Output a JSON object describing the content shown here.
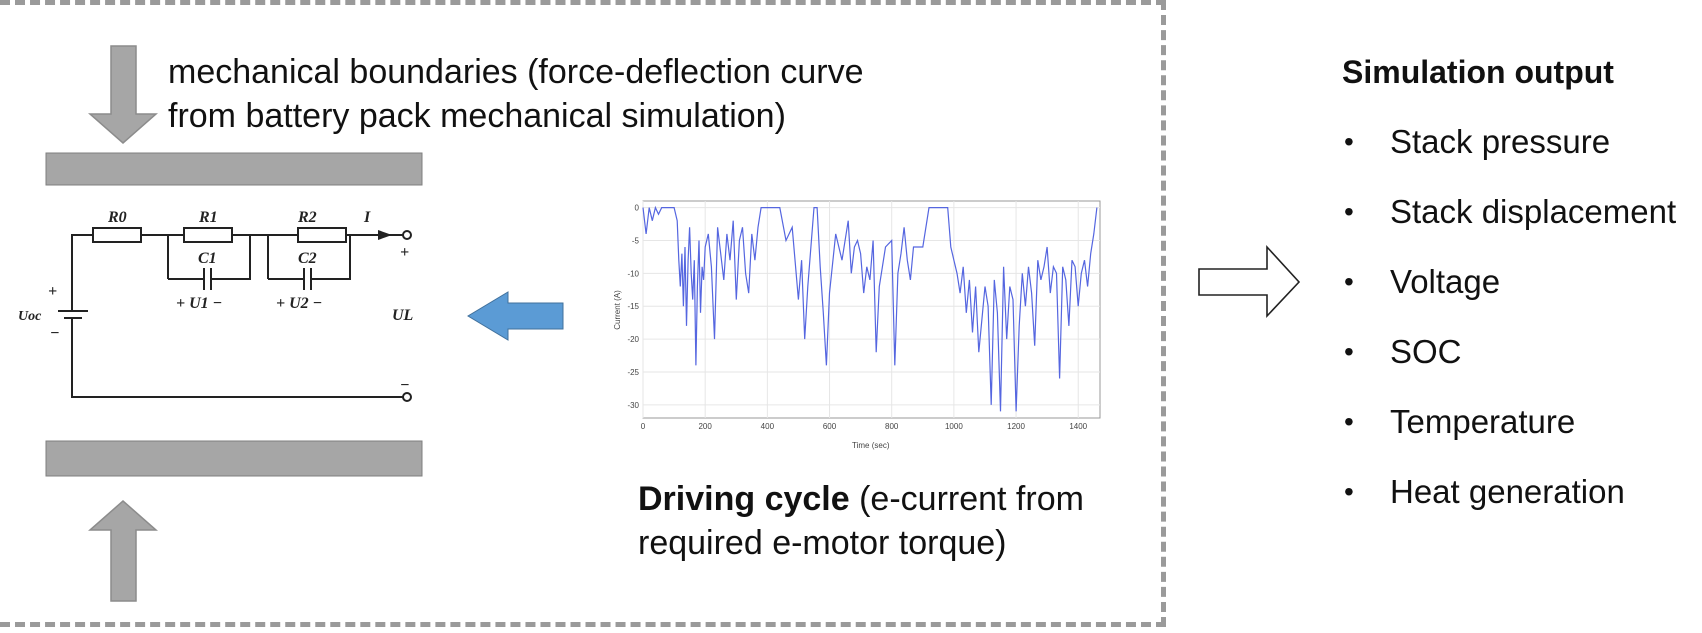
{
  "mechanical_label": {
    "line1": "mechanical boundaries (force-deflection curve",
    "line2": "from battery pack mechanical simulation)"
  },
  "circuit": {
    "R0": "R0",
    "R1": "R1",
    "R2": "R2",
    "C1": "C1",
    "C2": "C2",
    "U1": "+ U1 −",
    "U2": "+ U2 −",
    "Uoc": "Uoc",
    "I": "I",
    "UL": "UL",
    "plus": "+",
    "minus": "−"
  },
  "driving_cycle": {
    "bold": "Driving cycle",
    "rest_line1": " (e-current from",
    "line2": "required e-motor torque)"
  },
  "output": {
    "title": "Simulation output",
    "bullet": "•",
    "items": [
      "Stack pressure",
      "Stack displacement",
      "Voltage",
      "SOC",
      "Temperature",
      "Heat generation"
    ]
  },
  "colors": {
    "arrow_blue": "#5b9bd5",
    "plate_gray": "#a6a6a6",
    "line_blue": "#5566e0",
    "dash_gray": "#9a9a9a"
  },
  "chart_data": {
    "type": "line",
    "xlabel": "Time (sec)",
    "ylabel": "Current (A)",
    "xlim": [
      0,
      1470
    ],
    "ylim": [
      -32,
      1
    ],
    "x_ticks": [
      0,
      200,
      400,
      600,
      800,
      1000,
      1200,
      1400
    ],
    "y_ticks": [
      0,
      -5,
      -10,
      -15,
      -20,
      -25,
      -30
    ],
    "series": [
      {
        "x": [
          0,
          10,
          20,
          30,
          40,
          50,
          60,
          70,
          80,
          90,
          100,
          110,
          115,
          120,
          125,
          130,
          135,
          140,
          145,
          150,
          155,
          160,
          165,
          170,
          175,
          180,
          185,
          190,
          195,
          200,
          210,
          220,
          230,
          240,
          250,
          260,
          270,
          280,
          290,
          300,
          310,
          320,
          330,
          340,
          350,
          360,
          370,
          380,
          390,
          400,
          420,
          440,
          460,
          480,
          500,
          510,
          520,
          530,
          540,
          550,
          560,
          570,
          580,
          590,
          600,
          620,
          640,
          660,
          670,
          680,
          690,
          700,
          710,
          720,
          730,
          740,
          750,
          760,
          780,
          800,
          810,
          820,
          830,
          840,
          850,
          860,
          870,
          880,
          890,
          900,
          920,
          940,
          960,
          980,
          990,
          1000,
          1010,
          1020,
          1030,
          1040,
          1050,
          1060,
          1070,
          1080,
          1090,
          1100,
          1110,
          1120,
          1130,
          1140,
          1150,
          1160,
          1170,
          1180,
          1190,
          1200,
          1210,
          1220,
          1230,
          1240,
          1250,
          1260,
          1270,
          1280,
          1290,
          1300,
          1310,
          1320,
          1330,
          1340,
          1350,
          1360,
          1370,
          1380,
          1390,
          1400,
          1410,
          1420,
          1430,
          1440,
          1450,
          1460
        ],
        "y": [
          0,
          -4,
          0,
          -2,
          0,
          -1,
          0,
          0,
          0,
          0,
          0,
          -2,
          -8,
          -12,
          -7,
          -15,
          -6,
          -18,
          -8,
          -3,
          -10,
          -14,
          -8,
          -24,
          -12,
          -5,
          -16,
          -9,
          -11,
          -6,
          -4,
          -9,
          -20,
          -3,
          -7,
          -11,
          -4,
          -8,
          -2,
          -14,
          -5,
          -3,
          -10,
          -13,
          -4,
          -8,
          -3,
          0,
          0,
          0,
          0,
          0,
          -5,
          -3,
          -14,
          -8,
          -20,
          -12,
          -6,
          0,
          0,
          -9,
          -16,
          -24,
          -13,
          -4,
          -8,
          -2,
          -10,
          -6,
          -5,
          -7,
          -13,
          -9,
          -11,
          -5,
          -22,
          -12,
          -6,
          -5,
          -24,
          -10,
          -7,
          -3,
          -8,
          -11,
          -6,
          -6,
          -6,
          -6,
          0,
          0,
          0,
          0,
          -6,
          -8,
          -10,
          -13,
          -9,
          -16,
          -11,
          -19,
          -12,
          -22,
          -17,
          -12,
          -15,
          -30,
          -11,
          -16,
          -31,
          -9,
          -20,
          -12,
          -14,
          -31,
          -18,
          -10,
          -15,
          -9,
          -13,
          -21,
          -8,
          -11,
          -9,
          -6,
          -13,
          -9,
          -10,
          -26,
          -9,
          -11,
          -18,
          -8,
          -9,
          -15,
          -10,
          -8,
          -12,
          -7,
          -4,
          0
        ]
      }
    ]
  }
}
